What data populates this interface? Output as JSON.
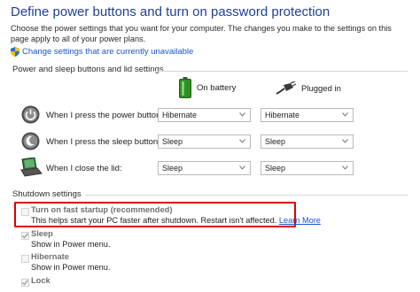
{
  "header": {
    "title": "Define power buttons and turn on password protection",
    "description": "Choose the power settings that you want for your computer. The changes you make to the settings on this page apply to all of your power plans.",
    "change_link": "Change settings that are currently unavailable"
  },
  "power_section": {
    "label": "Power and sleep buttons and lid settings",
    "columns": {
      "battery": "On battery",
      "plugged": "Plugged in"
    },
    "rows": [
      {
        "label": "When I press the power button:",
        "icon": "power-button-icon",
        "battery": "Hibernate",
        "plugged": "Hibernate"
      },
      {
        "label": "When I press the sleep button:",
        "icon": "sleep-button-icon",
        "battery": "Sleep",
        "plugged": "Sleep"
      },
      {
        "label": "When I close the lid:",
        "icon": "laptop-lid-icon",
        "battery": "Sleep",
        "plugged": "Sleep"
      }
    ]
  },
  "shutdown_section": {
    "label": "Shutdown settings",
    "fast_startup": {
      "label": "Turn on fast startup (recommended)",
      "description": "This helps start your PC faster after shutdown. Restart isn't affected.",
      "link": "Learn More",
      "checked": false
    },
    "options": [
      {
        "label": "Sleep",
        "description": "Show in Power menu.",
        "checked": true
      },
      {
        "label": "Hibernate",
        "description": "Show in Power menu.",
        "checked": false
      },
      {
        "label": "Lock",
        "checked": true
      }
    ]
  },
  "colors": {
    "title": "#1f3f99",
    "link": "#1c54c9",
    "highlight": "#e00000"
  }
}
